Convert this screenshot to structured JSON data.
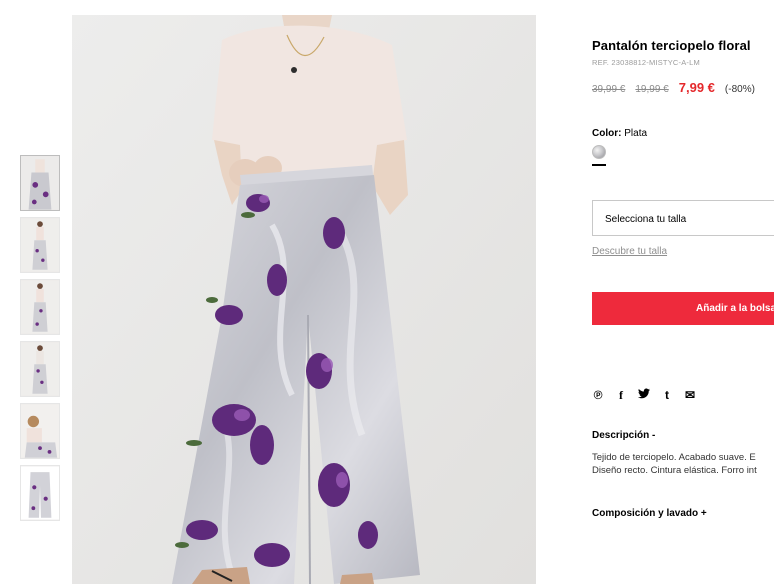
{
  "product": {
    "title": "Pantalón terciopelo floral",
    "ref": "REF. 23038812-MISTYC-A-LM",
    "price_original": "39,99 €",
    "price_previous": "19,99 €",
    "price_sale": "7,99 €",
    "discount": "(-80%)"
  },
  "color": {
    "label": "Color:",
    "value": "Plata",
    "swatch_color": "#c6c6c9"
  },
  "size": {
    "select_label": "Selecciona tu talla",
    "guide_link": "Descubre tu talla"
  },
  "cart": {
    "add_label": "Añadir a la bolsa",
    "button_color": "#ee2a3c"
  },
  "share": {
    "icons": [
      "pinterest-icon",
      "facebook-icon",
      "twitter-icon",
      "tumblr-icon",
      "email-icon"
    ],
    "glyphs": [
      "℗",
      "f",
      "🐦",
      "t",
      "✉"
    ]
  },
  "description": {
    "title": "Descripción -",
    "line1": "Tejido de terciopelo. Acabado suave. E",
    "line2": "Diseño recto. Cintura elástica. Forro int"
  },
  "composition": {
    "title": "Composición y lavado +"
  },
  "colors": {
    "sale": "#e4272a",
    "accent": "#ee2a3c"
  }
}
